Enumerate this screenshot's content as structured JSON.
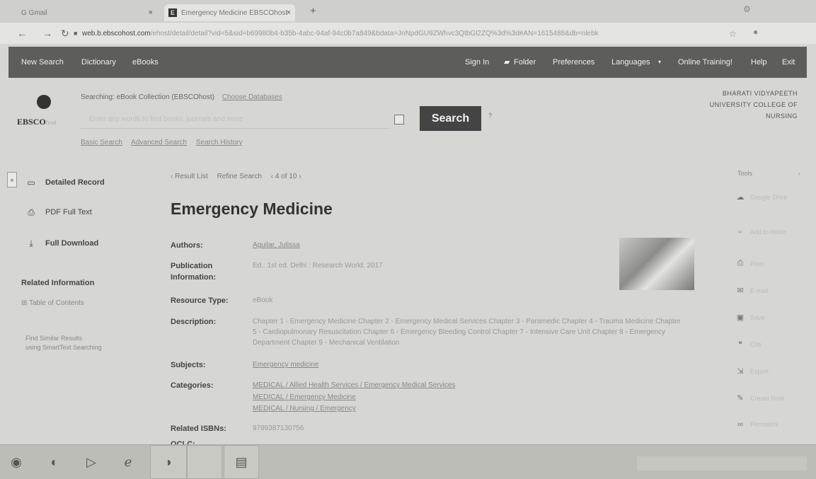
{
  "browser": {
    "tabs": [
      {
        "title": "G  Gmail",
        "icon": "gmail-icon"
      },
      {
        "title": "Emergency Medicine  EBSCOhost",
        "icon": "ebsco-favicon"
      }
    ],
    "tab_close": "×",
    "new_tab": "+",
    "url_domain": "web.b.ebscohost.com",
    "url_rest": "/ehost/detail/detail?vid=5&sid=b69980b4-b35b-4abc-94af-94c0b7a849&bdata=JnNpdGU9ZWhvc3QtbGl2ZQ%3d%3d#AN=1615488&db=nlebk"
  },
  "ebsco_nav": {
    "left": [
      "New Search",
      "Dictionary",
      "eBooks"
    ],
    "right": [
      "Sign In",
      "Folder",
      "Preferences",
      "Languages",
      "Online Training!",
      "Help",
      "Exit"
    ]
  },
  "search": {
    "searching_label": "Searching: eBook Collection (EBSCOhost)",
    "choose_db": "Choose Databases",
    "placeholder": "Enter any words to find books, journals and more",
    "button": "Search",
    "help": "?",
    "modes": [
      "Basic Search",
      "Advanced Search",
      "Search History"
    ]
  },
  "logo": {
    "text": "EBSCO",
    "host": "host"
  },
  "institution": [
    "BHARATI VIDYAPEETH",
    "UNIVERSITY COLLEGE OF",
    "NURSING"
  ],
  "sidebar": {
    "collapse": "«",
    "items": [
      {
        "label": "Detailed Record",
        "icon": "record-icon"
      },
      {
        "label": "PDF Full Text",
        "icon": "pdf-icon"
      },
      {
        "label": "Full Download",
        "icon": "download-icon"
      }
    ],
    "related_heading": "Related Information",
    "toc": "Table of Contents",
    "find_similar": [
      "Find Similar Results",
      "using SmartText Searching"
    ]
  },
  "record": {
    "crumbs": [
      "‹ Result List",
      "Refine Search",
      "‹ 4 of 10 ›"
    ],
    "title": "Emergency Medicine",
    "fields": [
      {
        "label": "Authors:",
        "value": "Aguilar, Julissa"
      },
      {
        "label": "Publication Information:",
        "value": "Ed.: 1st ed. Delhi : Research World. 2017"
      },
      {
        "label": "Resource Type:",
        "value": "eBook"
      },
      {
        "label": "Description:",
        "value": "Chapter 1 - Emergency Medicine Chapter 2 - Emergency Medical Services Chapter 3 - Paramedic Chapter 4 - Trauma Medicine Chapter 5 - Cardiopulmonary Resuscitation Chapter 6 - Emergency Bleeding Control Chapter 7 - Intensive Care Unit Chapter 8 - Emergency Department Chapter 9 - Mechanical Ventilation"
      },
      {
        "label": "Subjects:",
        "value": "Emergency medicine"
      },
      {
        "label": "Categories:",
        "value": [
          "MEDICAL / Allied Health Services / Emergency Medical Services",
          "MEDICAL / Emergency Medicine",
          "MEDICAL / Nursing / Emergency"
        ]
      },
      {
        "label": "Related ISBNs:",
        "value": "9789387130756"
      },
      {
        "label": "OCLC:",
        "value": ""
      }
    ]
  },
  "tools": {
    "heading": "Tools",
    "items": [
      "Google Drive",
      "Add to folder",
      "Print",
      "E-mail",
      "Save",
      "Cite",
      "Export",
      "Create Note",
      "Permalink"
    ]
  }
}
